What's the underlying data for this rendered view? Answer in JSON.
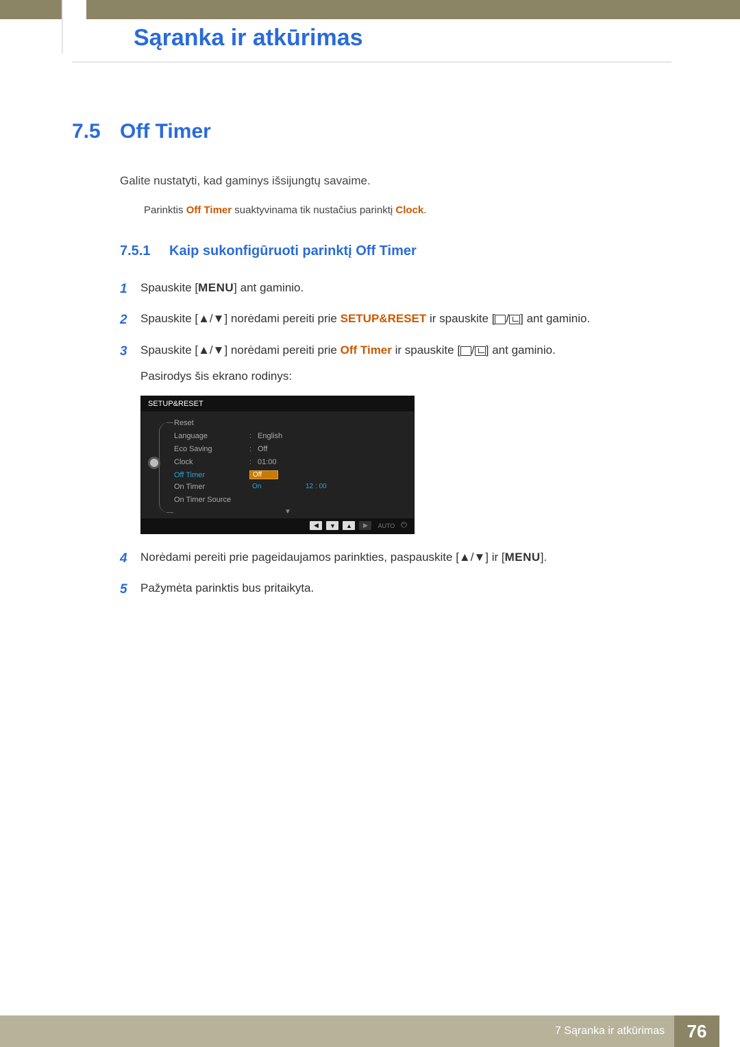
{
  "header": {
    "chapter_title": "Sąranka ir atkūrimas"
  },
  "section": {
    "number": "7.5",
    "title": "Off Timer"
  },
  "intro": "Galite nustatyti, kad gaminys išsijungtų savaime.",
  "note": {
    "pre": "Parinktis ",
    "hl1": "Off Timer",
    "mid": " suaktyvinama tik nustačius parinktį ",
    "hl2": "Clock",
    "post": "."
  },
  "subsection": {
    "number": "7.5.1",
    "title": "Kaip sukonfigūruoti parinktį Off Timer"
  },
  "labels": {
    "menu": "MENU",
    "setup_reset_hl": "SETUP&RESET",
    "off_timer_hl": "Off Timer"
  },
  "steps": {
    "s1": {
      "num": "1",
      "pre": "Spauskite [",
      "post": "] ant gaminio."
    },
    "s2": {
      "num": "2",
      "pre": "Spauskite [▲/▼] norėdami pereiti prie ",
      "mid": " ir spauskite [",
      "post": "] ant gaminio."
    },
    "s3": {
      "num": "3",
      "pre": "Spauskite [▲/▼] norėdami pereiti prie ",
      "mid": " ir spauskite [",
      "post": "] ant gaminio.",
      "after": "Pasirodys šis ekrano rodinys:"
    },
    "s4": {
      "num": "4",
      "pre": "Norėdami pereiti prie pageidaujamos parinkties, paspauskite [▲/▼] ir [",
      "post": "]."
    },
    "s5": {
      "num": "5",
      "text": "Pažymėta parinktis bus pritaikyta."
    }
  },
  "osd": {
    "title": "SETUP&RESET",
    "items": [
      {
        "label": "Reset",
        "value": ""
      },
      {
        "label": "Language",
        "value": "English"
      },
      {
        "label": "Eco Saving",
        "value": "Off"
      },
      {
        "label": "Clock",
        "value": "01:00"
      },
      {
        "label": "Off Timer",
        "value": "",
        "active": true
      },
      {
        "label": "On Timer",
        "value": ""
      },
      {
        "label": "On Timer Source",
        "value": ""
      }
    ],
    "submenu": {
      "off": "Off",
      "on": "On",
      "time": "12 : 00"
    },
    "footer_buttons": [
      "◀",
      "▼",
      "▲",
      "▶"
    ],
    "auto": "AUTO"
  },
  "footer": {
    "chapter": "7 Sąranka ir atkūrimas",
    "page": "76"
  }
}
